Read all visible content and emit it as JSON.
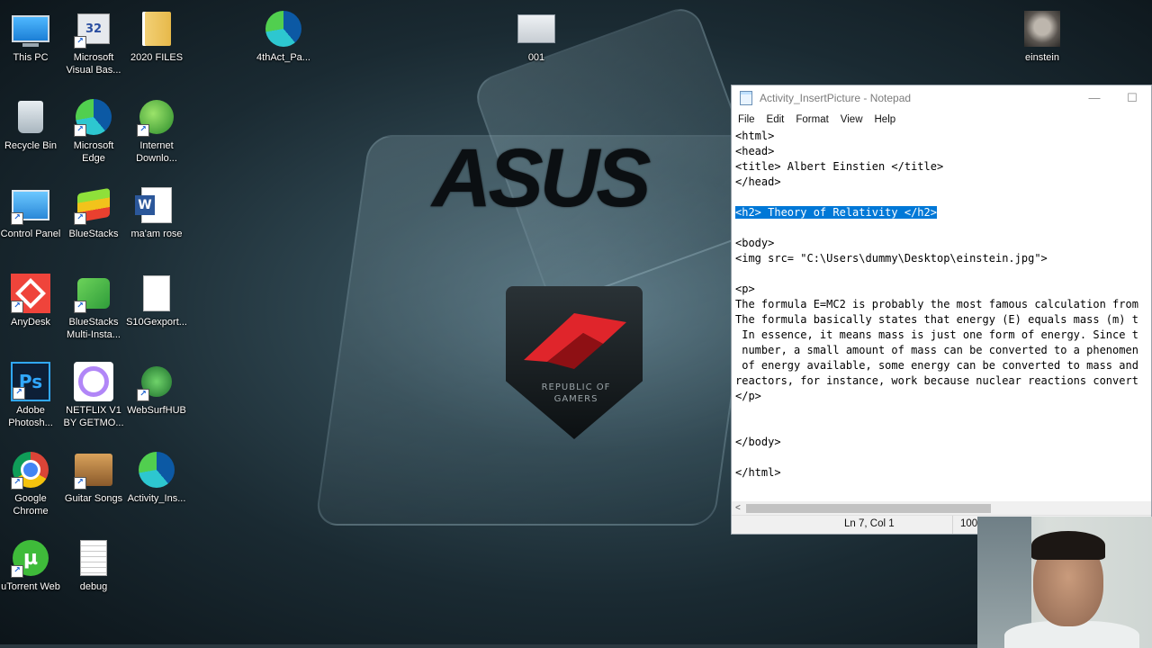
{
  "desktop": {
    "icons": [
      {
        "label": "This PC",
        "icon": "computer-icon"
      },
      {
        "label": "Microsoft Visual Bas...",
        "icon": "visual-basic-icon"
      },
      {
        "label": "2020 FILES",
        "icon": "folder-icon"
      },
      {
        "label": "4thAct_Pa...",
        "icon": "edge-icon"
      },
      {
        "label": "001",
        "icon": "image-file-icon"
      },
      {
        "label": "einstein",
        "icon": "einstein-photo-icon"
      },
      {
        "label": "Recycle Bin",
        "icon": "recycle-bin-icon"
      },
      {
        "label": "Microsoft Edge",
        "icon": "edge-icon"
      },
      {
        "label": "Internet Downlo...",
        "icon": "internet-download-manager-icon"
      },
      {
        "label": "Control Panel",
        "icon": "control-panel-icon"
      },
      {
        "label": "BlueStacks",
        "icon": "bluestacks-icon"
      },
      {
        "label": "ma'am rose",
        "icon": "word-document-icon"
      },
      {
        "label": "AnyDesk",
        "icon": "anydesk-icon"
      },
      {
        "label": "BlueStacks Multi-Insta...",
        "icon": "bluestacks-multi-icon"
      },
      {
        "label": "S10Gexport...",
        "icon": "blank-file-icon"
      },
      {
        "label": "Adobe Photosh...",
        "icon": "photoshop-icon"
      },
      {
        "label": "NETFLIX V1 BY GETMO...",
        "icon": "netflix-ring-icon"
      },
      {
        "label": "WebSurfHUB",
        "icon": "websurf-icon"
      },
      {
        "label": "Google Chrome",
        "icon": "chrome-icon"
      },
      {
        "label": "Guitar Songs",
        "icon": "guitar-folder-icon"
      },
      {
        "label": "Activity_Ins...",
        "icon": "edge-icon"
      },
      {
        "label": "uTorrent Web",
        "icon": "utorrent-icon"
      },
      {
        "label": "debug",
        "icon": "text-file-icon"
      }
    ],
    "wallpaper": {
      "brand": "ASUS",
      "emblem_line1": "REPUBLIC OF",
      "emblem_line2": "GAMERS"
    }
  },
  "notepad": {
    "title": "Activity_InsertPicture - Notepad",
    "minimize": "—",
    "maximize": "☐",
    "menu": [
      "File",
      "Edit",
      "Format",
      "View",
      "Help"
    ],
    "lines": [
      "<html>",
      "<head>",
      "<title> Albert Einstien </title>",
      "</head>",
      "",
      "<h2> Theory of Relativity </h2>",
      "",
      "<body>",
      "<img src= \"C:\\Users\\dummy\\Desktop\\einstein.jpg\">",
      "",
      "<p>",
      "The formula E=MC2 is probably the most famous calculation from",
      "The formula basically states that energy (E) equals mass (m) t",
      " In essence, it means mass is just one form of energy. Since t",
      " number, a small amount of mass can be converted to a phenomen",
      " of energy available, some energy can be converted to mass and",
      "reactors, for instance, work because nuclear reactions convert",
      "</p>",
      "",
      "",
      "</body>",
      "",
      "</html>"
    ],
    "selected_line_index": 5,
    "scroll_left_arrow": "<",
    "status": {
      "position": "Ln 7, Col 1",
      "zoom": "100%"
    }
  },
  "colors": {
    "selection": "#0078d7",
    "desktop_text": "#ffffff"
  }
}
